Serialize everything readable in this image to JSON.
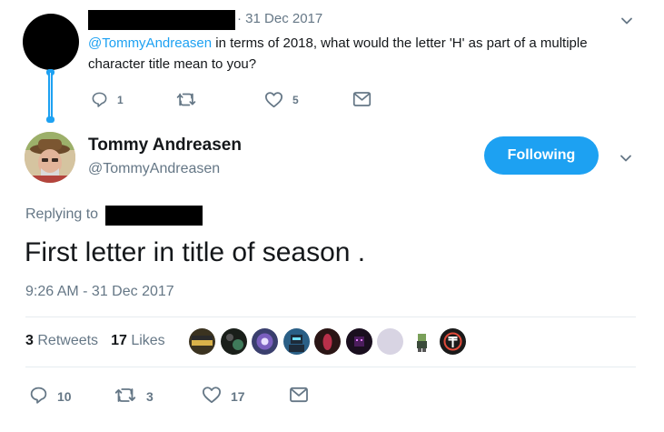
{
  "parent_tweet": {
    "date": "· 31 Dec 2017",
    "mention": "@TommyAndreasen",
    "text": " in terms of 2018, what would the letter 'H' as part of a multiple character title mean to you?",
    "reply_count": "1",
    "retweet_count": "",
    "like_count": "5"
  },
  "tweet": {
    "display_name": "Tommy Andreasen",
    "handle": "@TommyAndreasen",
    "follow_label": "Following",
    "replying_to_label": "Replying to",
    "text": "First letter in title of season .",
    "timestamp": "9:26 AM - 31 Dec 2017",
    "retweets_count": "3",
    "retweets_label": "Retweets",
    "likes_count": "17",
    "likes_label": "Likes",
    "reply_count": "10",
    "retweet_count": "3",
    "like_count": "17"
  },
  "likers": [
    {
      "name": "liker-avatar-1",
      "color": "#3b3320"
    },
    {
      "name": "liker-avatar-2",
      "color": "#1a1f1a"
    },
    {
      "name": "liker-avatar-3",
      "color": "#3a3f6e"
    },
    {
      "name": "liker-avatar-4",
      "color": "#2a5f86"
    },
    {
      "name": "liker-avatar-5",
      "color": "#2a1515"
    },
    {
      "name": "liker-avatar-6",
      "color": "#1a0f1f"
    },
    {
      "name": "liker-avatar-7",
      "color": "#d8d4e3"
    },
    {
      "name": "liker-avatar-8",
      "color": "#ffffff"
    },
    {
      "name": "liker-avatar-9",
      "color": "#1a1a1a"
    }
  ],
  "colors": {
    "accent": "#1da1f2",
    "muted": "#657786",
    "text": "#14171a"
  },
  "icons": [
    "chevron-down-icon",
    "reply-icon",
    "retweet-icon",
    "heart-icon",
    "message-icon"
  ]
}
